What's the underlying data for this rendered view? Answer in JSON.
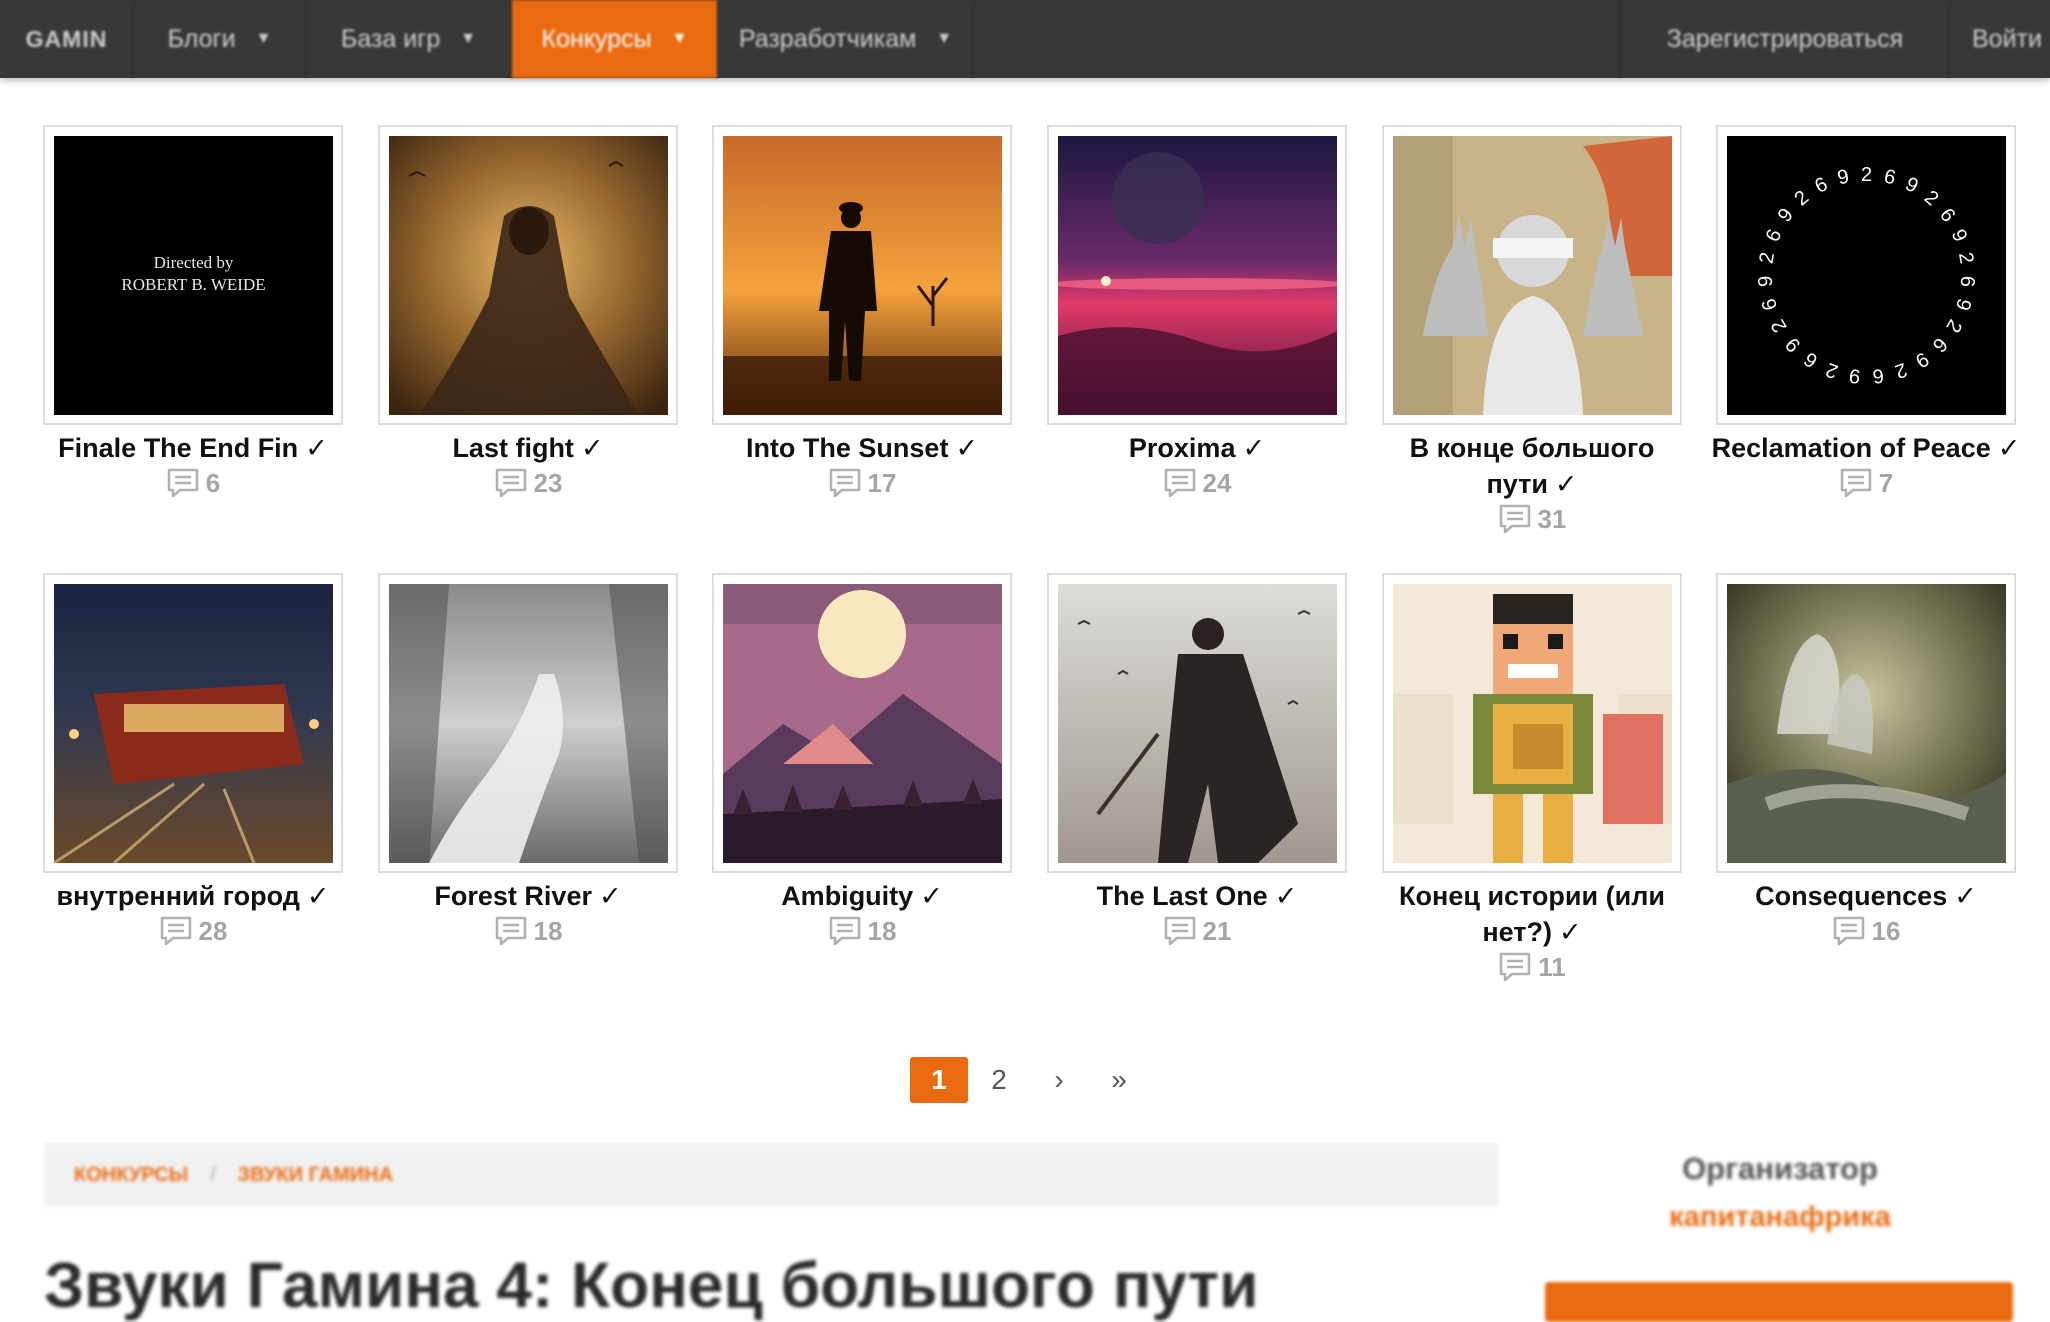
{
  "nav": {
    "logo": "GAMIN",
    "blogs": "Блоги",
    "games_db": "База игр",
    "contests": "Конкурсы",
    "developers": "Разработчикам",
    "register": "Зарегистрироваться",
    "login": "Войти"
  },
  "colors": {
    "accent": "#ea6a0f",
    "nav_bg": "#383838"
  },
  "entries": [
    {
      "title": "Finale The End Fin",
      "comments": "6",
      "thumb_text": [
        "Directed by",
        "ROBERT B. WEIDE"
      ]
    },
    {
      "title": "Last fight",
      "comments": "23"
    },
    {
      "title": "Into The Sunset",
      "comments": "17"
    },
    {
      "title": "Proxima",
      "comments": "24"
    },
    {
      "title": "В конце большого пути",
      "comments": "31"
    },
    {
      "title": "Reclamation of Peace",
      "comments": "7",
      "thumb_text": [
        "2",
        "6",
        "9"
      ]
    },
    {
      "title": "внутренний город",
      "comments": "28"
    },
    {
      "title": "Forest River",
      "comments": "18"
    },
    {
      "title": "Ambiguity",
      "comments": "18"
    },
    {
      "title": "The Last One",
      "comments": "21"
    },
    {
      "title": "Конец истории (или нет?)",
      "comments": "11"
    },
    {
      "title": "Consequences",
      "comments": "16"
    }
  ],
  "check_mark": "✓",
  "comment_icon": "speech-bubble-icon",
  "pagination": {
    "current": "1",
    "next_page": "2",
    "next": "›",
    "last": "»"
  },
  "breadcrumb": {
    "section": "КОНКУРСЫ",
    "separator": "/",
    "current": "ЗВУКИ ГАМИНА"
  },
  "contest_title": "Звуки Гамина 4: Конец большого пути",
  "organizer": {
    "label": "Организатор",
    "name": "капитанафрика"
  }
}
